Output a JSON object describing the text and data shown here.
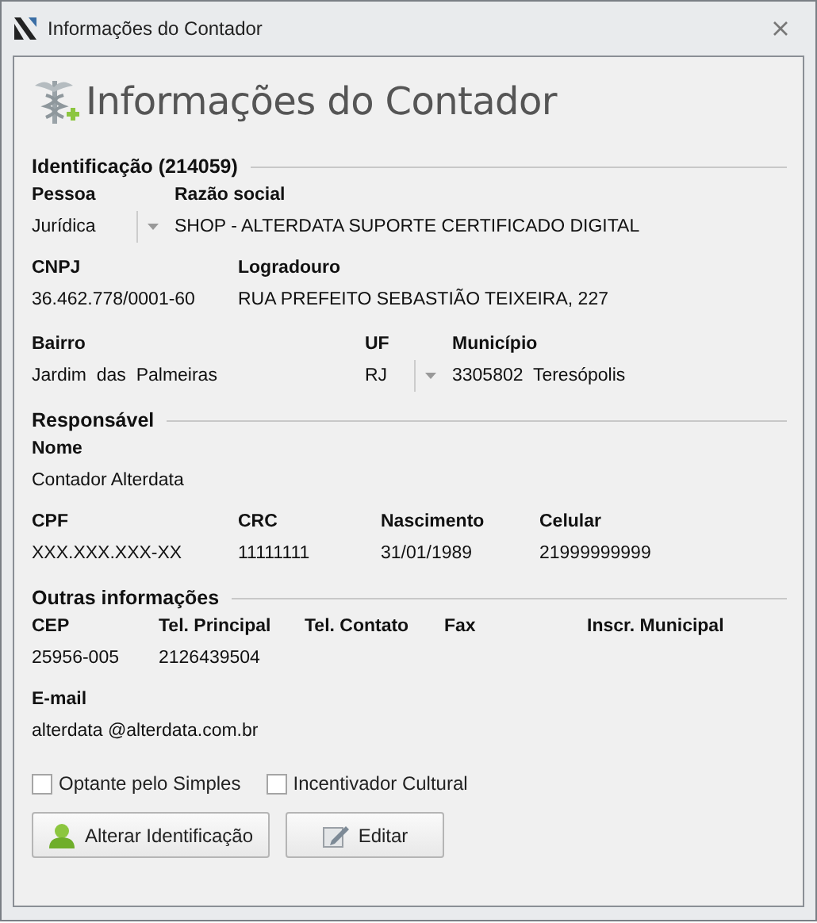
{
  "window": {
    "title": "Informações do Contador"
  },
  "header": {
    "title": "Informações do Contador"
  },
  "sections": [
    {
      "title": "Identificação (214059)",
      "rows": [
        [
          {
            "label": "Pessoa",
            "value": "Jurídica",
            "kind": "dropdown"
          },
          {
            "label": "Razão social",
            "value": "SHOP - ALTERDATA SUPORTE CERTIFICADO DIGITAL",
            "kind": "text"
          }
        ],
        [
          {
            "label": "CNPJ",
            "value": "36.462.778/0001-60",
            "kind": "text"
          },
          {
            "label": "Logradouro",
            "value": "RUA PREFEITO SEBASTIÃO TEIXEIRA, 227",
            "kind": "text"
          }
        ],
        [
          {
            "label": "Bairro",
            "value": "Jardim  das  Palmeiras",
            "kind": "text"
          },
          {
            "label": "UF",
            "value": "RJ",
            "kind": "dropdown"
          },
          {
            "label": "Município",
            "value": "3305802  Teresópolis",
            "kind": "text"
          }
        ]
      ]
    },
    {
      "title": "Responsável",
      "rows": [
        [
          {
            "label": "Nome",
            "value": "Contador Alterdata",
            "kind": "text"
          }
        ],
        [
          {
            "label": "CPF",
            "value": "XXX.XXX.XXX-XX",
            "kind": "text"
          },
          {
            "label": "CRC",
            "value": "11111111",
            "kind": "text"
          },
          {
            "label": "Nascimento",
            "value": "31/01/1989",
            "kind": "text"
          },
          {
            "label": "Celular",
            "value": "21999999999",
            "kind": "text"
          }
        ]
      ]
    },
    {
      "title": "Outras informações",
      "rows": [
        [
          {
            "label": "CEP",
            "value": "25956-005",
            "kind": "text"
          },
          {
            "label": "Tel. Principal",
            "value": "2126439504",
            "kind": "text"
          },
          {
            "label": "Tel. Contato",
            "kind": "text"
          },
          {
            "label": "Fax",
            "kind": "text"
          },
          {
            "label": "Inscr. Municipal",
            "kind": "text"
          }
        ],
        [
          {
            "label": "E-mail",
            "value": "alterdata @alterdata.com.br",
            "kind": "text"
          }
        ]
      ]
    }
  ],
  "checkboxes": [
    {
      "label": "Optante pelo Simples",
      "checked": false
    },
    {
      "label": "Incentivador Cultural",
      "checked": false
    }
  ],
  "buttons": [
    {
      "label": "Alterar Identificação"
    },
    {
      "label": "Editar"
    }
  ]
}
